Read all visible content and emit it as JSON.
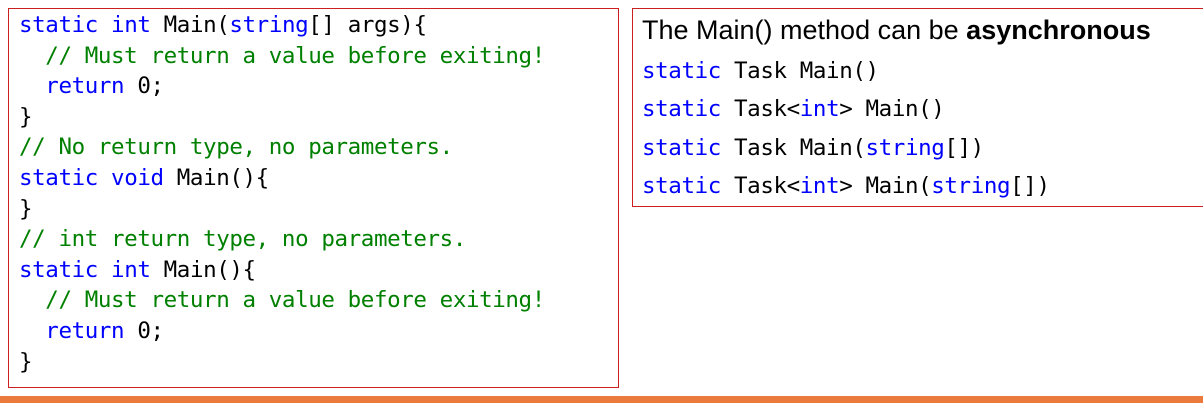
{
  "left_panel": {
    "lines": [
      {
        "indent": "",
        "parts": [
          [
            "kw",
            "static"
          ],
          [
            "t",
            " "
          ],
          [
            "kw",
            "int"
          ],
          [
            "t",
            " Main("
          ],
          [
            "kw",
            "string"
          ],
          [
            "t",
            "[] args){"
          ]
        ]
      },
      {
        "indent": "  ",
        "parts": [
          [
            "cm",
            "// Must return a value before exiting!"
          ]
        ]
      },
      {
        "indent": "  ",
        "parts": [
          [
            "kw",
            "return"
          ],
          [
            "t",
            " 0;"
          ]
        ]
      },
      {
        "indent": "",
        "parts": [
          [
            "t",
            "}"
          ]
        ]
      },
      {
        "indent": "",
        "parts": [
          [
            "cm",
            "// No return type, no parameters."
          ]
        ]
      },
      {
        "indent": "",
        "parts": [
          [
            "kw",
            "static"
          ],
          [
            "t",
            " "
          ],
          [
            "kw",
            "void"
          ],
          [
            "t",
            " Main(){"
          ]
        ]
      },
      {
        "indent": "",
        "parts": [
          [
            "t",
            "}"
          ]
        ]
      },
      {
        "indent": "",
        "parts": [
          [
            "cm",
            "// int return type, no parameters."
          ]
        ]
      },
      {
        "indent": "",
        "parts": [
          [
            "kw",
            "static"
          ],
          [
            "t",
            " "
          ],
          [
            "kw",
            "int"
          ],
          [
            "t",
            " Main(){"
          ]
        ]
      },
      {
        "indent": "  ",
        "parts": [
          [
            "cm",
            "// Must return a value before exiting!"
          ]
        ]
      },
      {
        "indent": "  ",
        "parts": [
          [
            "kw",
            "return"
          ],
          [
            "t",
            " 0;"
          ]
        ]
      },
      {
        "indent": "",
        "parts": [
          [
            "t",
            "}"
          ]
        ]
      }
    ]
  },
  "right_panel": {
    "heading_prefix": "The Main() method can be ",
    "heading_emphasis": "asynchronous",
    "lines": [
      {
        "indent": "",
        "parts": [
          [
            "kw",
            "static"
          ],
          [
            "t",
            " Task Main()"
          ]
        ]
      },
      {
        "indent": "",
        "parts": [
          [
            "kw",
            "static"
          ],
          [
            "t",
            " Task<"
          ],
          [
            "kw",
            "int"
          ],
          [
            "t",
            "> Main()"
          ]
        ]
      },
      {
        "indent": "",
        "parts": [
          [
            "kw",
            "static"
          ],
          [
            "t",
            " Task Main("
          ],
          [
            "kw",
            "string"
          ],
          [
            "t",
            "[])"
          ]
        ]
      },
      {
        "indent": "",
        "parts": [
          [
            "kw",
            "static"
          ],
          [
            "t",
            " Task<"
          ],
          [
            "kw",
            "int"
          ],
          [
            "t",
            "> Main("
          ],
          [
            "kw",
            "string"
          ],
          [
            "t",
            "[])"
          ]
        ]
      }
    ]
  },
  "colors": {
    "keyword": "#0000ff",
    "comment": "#008000",
    "text": "#000000",
    "border": "#cc1f1f",
    "accent_bar": "#ea7b3c"
  }
}
